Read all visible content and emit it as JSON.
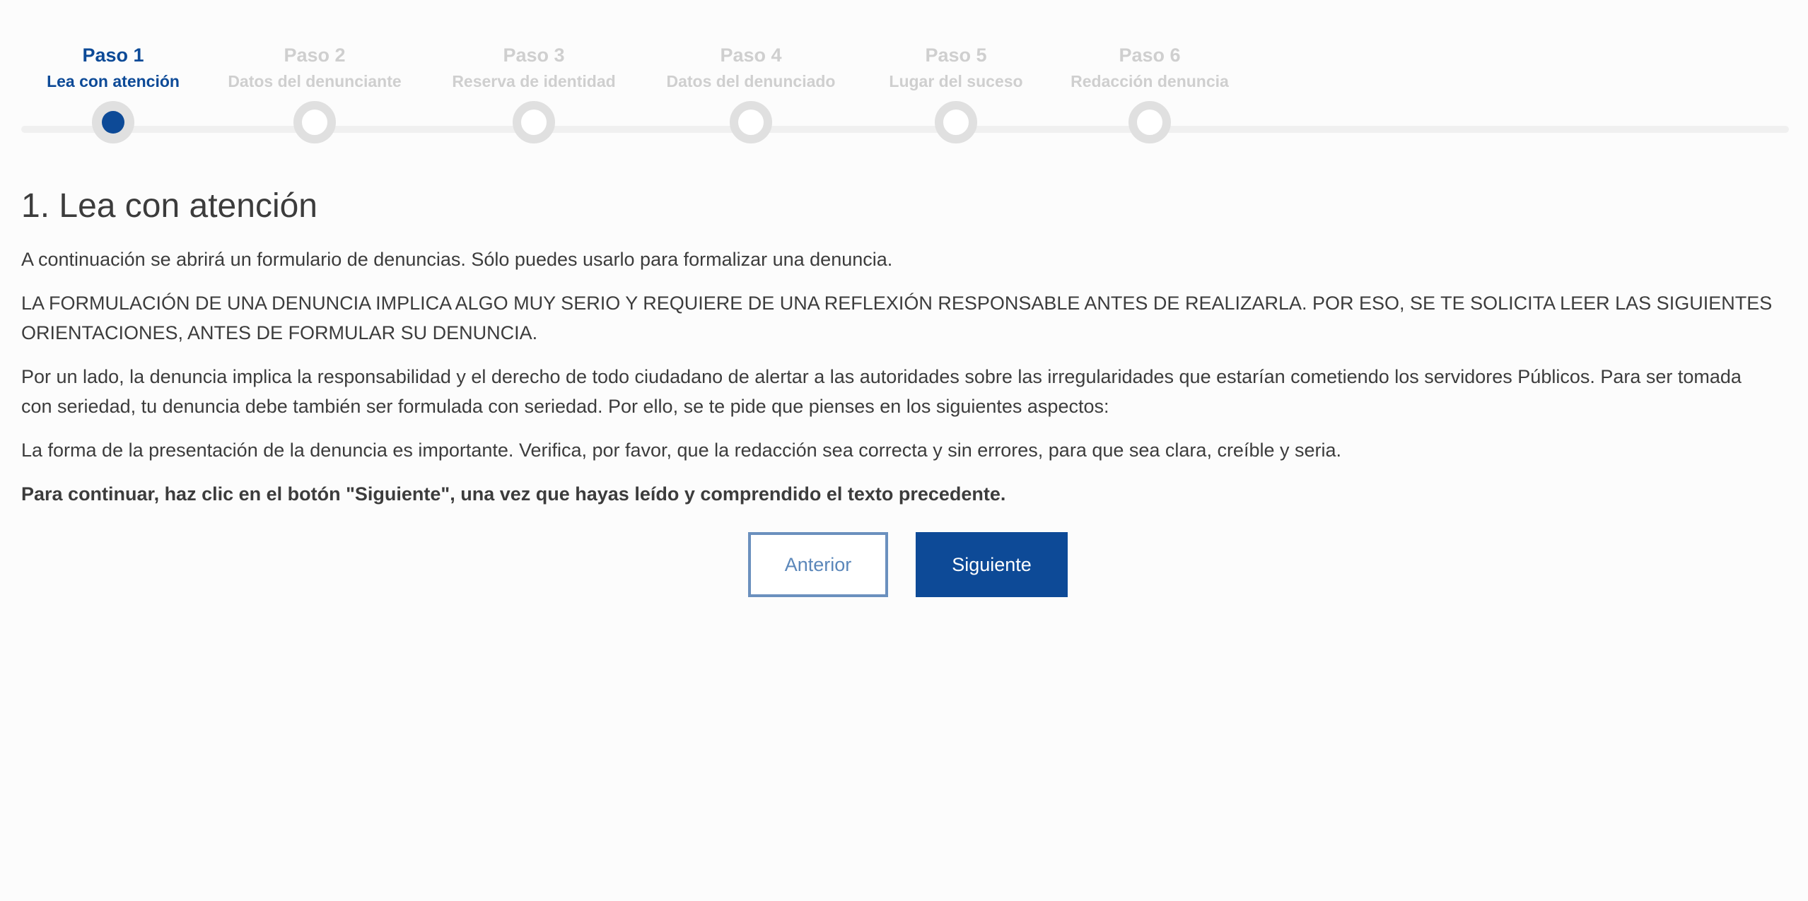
{
  "stepper": {
    "steps": [
      {
        "title": "Paso 1",
        "subtitle": "Lea con atención",
        "active": true
      },
      {
        "title": "Paso 2",
        "subtitle": "Datos del denunciante",
        "active": false
      },
      {
        "title": "Paso 3",
        "subtitle": "Reserva de identidad",
        "active": false
      },
      {
        "title": "Paso 4",
        "subtitle": "Datos del denunciado",
        "active": false
      },
      {
        "title": "Paso 5",
        "subtitle": "Lugar del suceso",
        "active": false
      },
      {
        "title": "Paso 6",
        "subtitle": "Redacción denuncia",
        "active": false
      }
    ]
  },
  "main": {
    "title": "1. Lea con atención",
    "paragraphs": [
      "A continuación se abrirá un formulario de denuncias. Sólo puedes usarlo para formalizar una denuncia.",
      "LA FORMULACIÓN DE UNA DENUNCIA IMPLICA ALGO MUY SERIO Y REQUIERE DE UNA REFLEXIÓN RESPONSABLE ANTES DE REALIZARLA. POR ESO, SE TE SOLICITA LEER LAS SIGUIENTES ORIENTACIONES, ANTES DE FORMULAR SU DENUNCIA.",
      "Por un lado, la denuncia implica la responsabilidad y el derecho de todo ciudadano de alertar a las autoridades sobre las irregularidades que estarían cometiendo los servidores Públicos. Para ser tomada con seriedad, tu denuncia debe también ser formulada con seriedad. Por ello, se te pide que pienses en los siguientes aspectos:",
      "La forma de la presentación de la denuncia es importante. Verifica, por favor, que la redacción sea correcta y sin errores, para que sea clara, creíble y seria."
    ],
    "instruction": "Para continuar, haz clic en el botón \"Siguiente\", una vez que hayas leído y comprendido el texto precedente."
  },
  "buttons": {
    "prev_label": "Anterior",
    "next_label": "Siguiente"
  },
  "colors": {
    "primary": "#0d4a97",
    "inactive": "#cfcfcf",
    "text": "#3c3c3c",
    "outline": "#6b90be"
  }
}
